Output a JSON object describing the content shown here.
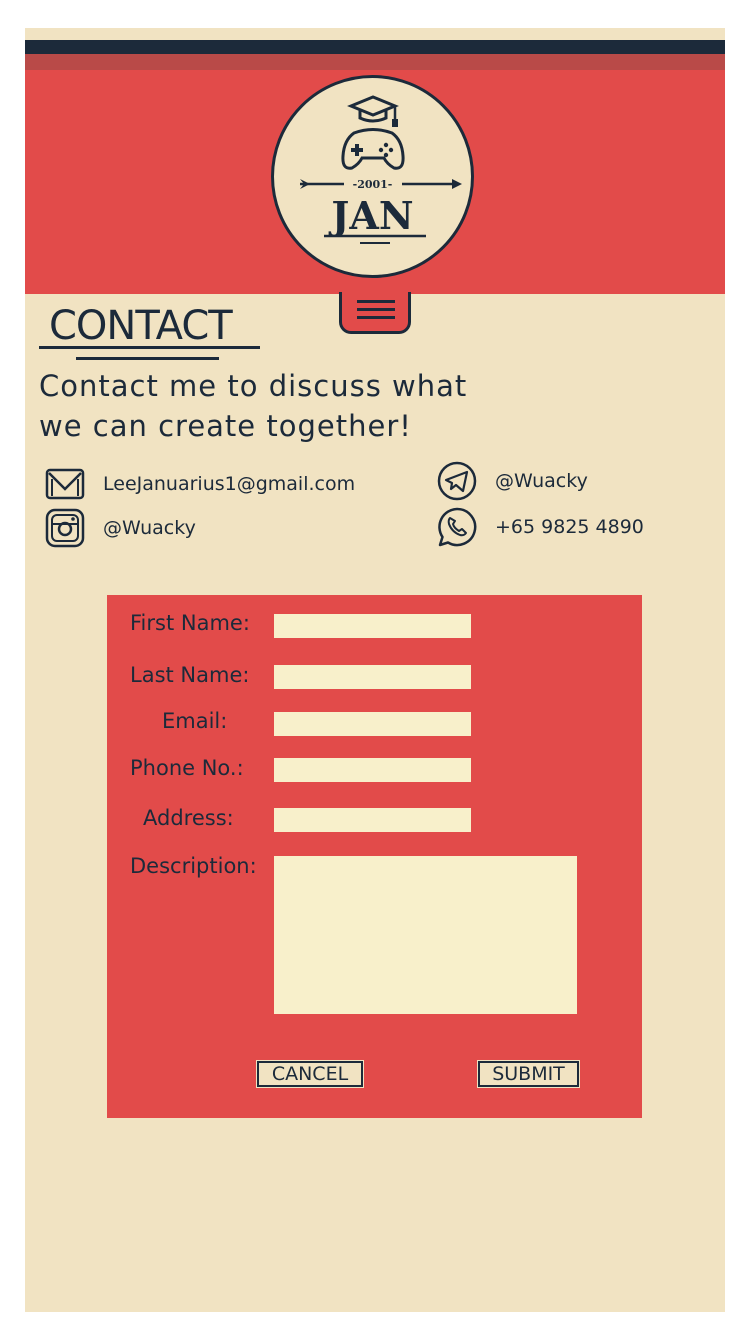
{
  "logo": {
    "year": "-2001-",
    "name": "JAN"
  },
  "contact": {
    "title": "CONTACT",
    "intro_line1": "Contact me to discuss what",
    "intro_line2": "we can create together!"
  },
  "socials": [
    {
      "icon": "mail-icon",
      "text": "LeeJanuarius1@gmail.com"
    },
    {
      "icon": "telegram-icon",
      "text": "@Wuacky"
    },
    {
      "icon": "instagram-icon",
      "text": "@Wuacky"
    },
    {
      "icon": "whatsapp-icon",
      "text": "+65 9825 4890"
    }
  ],
  "form": {
    "first_name_label": "First Name:",
    "last_name_label": "Last Name:",
    "email_label": "Email:",
    "phone_label": "Phone No.:",
    "address_label": "Address:",
    "description_label": "Description:",
    "first_name_value": "",
    "last_name_value": "",
    "email_value": "",
    "phone_value": "",
    "address_value": "",
    "description_value": "",
    "cancel_label": "CANCEL",
    "submit_label": "SUBMIT"
  },
  "colors": {
    "page_bg": "#f1e3c2",
    "accent_red": "#e24b4a",
    "navy": "#1c2a3a",
    "field_bg": "#f8f0cb"
  }
}
